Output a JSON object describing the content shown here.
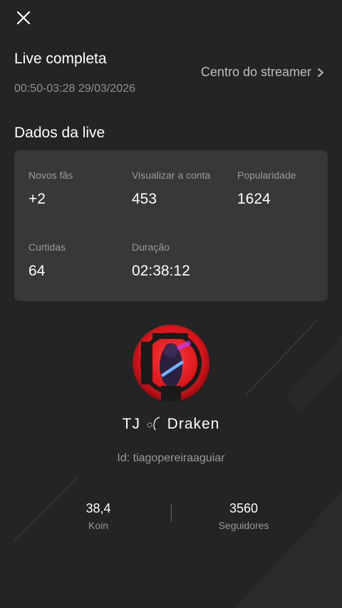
{
  "header": {
    "title": "Live completa",
    "time_range": "00:50-03:28 29/03/2026",
    "streamer_center_label": "Centro do streamer"
  },
  "live_data": {
    "section_title": "Dados da live",
    "stats": [
      {
        "label": "Novos fãs",
        "value": "+2"
      },
      {
        "label": "Visualizar a conta",
        "value": "453"
      },
      {
        "label": "Popularidade",
        "value": "1624"
      },
      {
        "label": "Curtidas",
        "value": "64"
      },
      {
        "label": "Duração",
        "value": "02:38:12"
      }
    ]
  },
  "profile": {
    "name_prefix": "TJ",
    "name_suffix": "Draken",
    "id_text": "Id: tiagopereiraaguiar",
    "counters": [
      {
        "value": "38,4",
        "label": "Koin"
      },
      {
        "value": "3560",
        "label": "Seguidores"
      }
    ]
  },
  "icons": {
    "close": "close-icon",
    "chevron": "chevron-right-icon"
  },
  "colors": {
    "background": "#242424",
    "card": "#383838",
    "muted_text": "#9a9a9a",
    "avatar_accent": "#e0161c"
  }
}
